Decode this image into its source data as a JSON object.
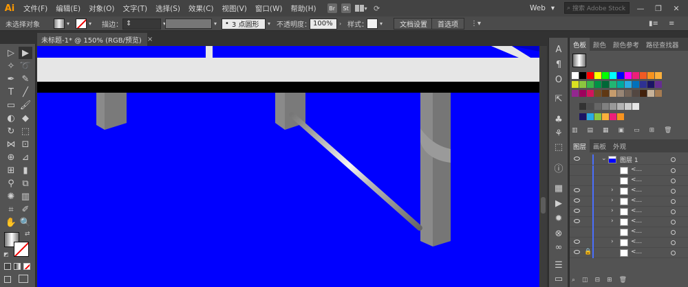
{
  "app": {
    "logo": "Ai"
  },
  "menu": [
    "文件(F)",
    "编辑(E)",
    "对象(O)",
    "文字(T)",
    "选择(S)",
    "效果(C)",
    "视图(V)",
    "窗口(W)",
    "帮助(H)"
  ],
  "menu_icons": [
    "Br",
    "St"
  ],
  "workspace": {
    "label": "Web",
    "caret": "▾"
  },
  "search": {
    "placeholder": "搜索 Adobe Stock"
  },
  "control": {
    "selection_label": "未选择对象",
    "stroke_label": "描边：",
    "brush_label": "3 点圆形",
    "opacity_label": "不透明度：",
    "opacity_value": "100%",
    "style_label": "样式：",
    "doc_setup": "文档设置",
    "prefs": "首选项"
  },
  "document": {
    "tab_title": "未标题-1* @ 150% (RGB/预览)",
    "close": "×"
  },
  "colors": {
    "canvas": "#0000ff",
    "accent": "#ff9a00",
    "pole": "#808080",
    "band": "#e6e6e6"
  },
  "swatch_panel": {
    "tabs": [
      "色板",
      "颜色",
      "颜色参考",
      "路径查找器"
    ],
    "rows": [
      [
        "#ffffff",
        "#000000",
        "#ff0000",
        "#ffff00",
        "#00ff00",
        "#00ffff",
        "#0000ff",
        "#ff00ff",
        "#ed1e79",
        "#f15a24",
        "#f7931e",
        "#fbb03b"
      ],
      [
        "#d9e021",
        "#8cc63f",
        "#39b54a",
        "#009245",
        "#006837",
        "#22b573",
        "#00a99d",
        "#29abe2",
        "#0071bc",
        "#2e3192",
        "#1b1464",
        "#662d91"
      ],
      [
        "#93278f",
        "#9e005d",
        "#d4145a",
        "#754c24",
        "#603813",
        "#c69c6d",
        "#998675",
        "#736357",
        "#534741",
        "#42210b",
        "#c7b299",
        "#a67c52"
      ],
      [
        "#333333",
        "#4d4d4d",
        "#666666",
        "#808080",
        "#999999",
        "#b3b3b3",
        "#cccccc",
        "#e6e6e6"
      ],
      [
        "#1b1464",
        "#29abe2",
        "#8cc63f",
        "#fbb03b",
        "#ed1e79",
        "#f7931e"
      ]
    ]
  },
  "layers_panel": {
    "tabs": [
      "图层",
      "画板",
      "外观"
    ],
    "top_layer": "图层 1",
    "sublayer_label": "<..."
  },
  "right_strip_icons": [
    "character-icon",
    "paragraph-icon",
    "opentype-icon",
    "export-icon",
    "symbols-icon",
    "graphic-styles-icon",
    "brushes-icon",
    "info-icon",
    "navigator-icon",
    "actions-icon",
    "transform-icon",
    "links-icon",
    "align-icon",
    "transparency-icon",
    "gradient-icon"
  ]
}
